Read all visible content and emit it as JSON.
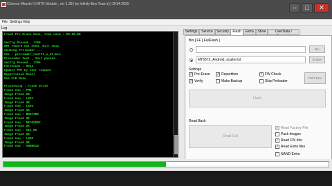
{
  "window": {
    "title": "Chinese Miracle II | MTK Module , ver 1.38 | by Infinity-Box Team (c) 2014-2016",
    "minimize_glyph": "–",
    "maximize_glyph": "□",
    "close_glyph": "✕"
  },
  "menu": {
    "items": [
      "File",
      "Settings",
      "Help"
    ]
  },
  "log": {
    "title": "Log",
    "lines": [
      "Flash Pre-Erase Done, time used : 00:00:00",
      "",
      "SecCfg Passed , 1799",
      "BRT rework not need. Will skip",
      "Sending Preloader ...",
      "Use : preloader_ccmt72_w_k2.bin",
      "Preloader Sent , Init passed",
      "SecCfg Passed , 1799",
      "PartCount : 0012",
      "Update PMT by user request",
      "Repartition Done!",
      "Use FLB Mode",
      "",
      "Processing : Flash Write",
      "Flash now : PMK",
      "Image Flash OK",
      "Flash now : LK01",
      "Image Flash OK",
      "Flash now : LK03",
      "Image Flash OK",
      "Flash now : BOOTIMG",
      "Image Flash OK",
      "Flash now : RECOVERY",
      "Image Flash OK",
      "Flash now : SEC_RO",
      "Image Flash OK",
      "Flash now : LOGO",
      "Image Flash OK",
      "Flash now : ANDROID"
    ],
    "text_color": "#22e022"
  },
  "tabs": [
    {
      "label": "Settings",
      "active": false
    },
    {
      "label": "Service",
      "active": false
    },
    {
      "label": "Security",
      "active": false
    },
    {
      "label": "Flash",
      "active": true
    },
    {
      "label": "Extra",
      "active": false
    },
    {
      "label": "Store",
      "active": false
    },
    {
      "label": "UserData / Forensic",
      "active": false
    }
  ],
  "flash_panel": {
    "bin_label": "Bin  [ FF ] FullFlash ]",
    "bin_path_value": "",
    "bin_button": "Bin",
    "scatter_value": "MT6572_Android_scatter.txt",
    "scatter_button": "Scatter",
    "settings_label": "Settings",
    "checks": [
      {
        "label": "Pre-Erase",
        "checked": true
      },
      {
        "label": "Repartition",
        "checked": true
      },
      {
        "label": "FW Check",
        "checked": true
      },
      {
        "label": "Verify",
        "checked": true
      },
      {
        "label": "Make Backup",
        "checked": false
      },
      {
        "label": "Skip Preloader",
        "checked": false
      }
    ],
    "pmt_button": "PMT Res",
    "flash_button": "Flash",
    "read_back_label": "Read Back",
    "read_full_button": "Read Full",
    "read_checks": [
      {
        "label": "Read Factory File",
        "checked": false,
        "enabled": false
      },
      {
        "label": "Pack Images",
        "checked": false,
        "enabled": true
      },
      {
        "label": "Read FW Info",
        "checked": true,
        "enabled": true
      },
      {
        "label": "Read Extra files",
        "checked": true,
        "enabled": true
      },
      {
        "label": "NAND Extra",
        "checked": false,
        "enabled": true
      }
    ]
  },
  "status": {
    "progress_percent": 50,
    "progress_color": "#12b51c"
  }
}
